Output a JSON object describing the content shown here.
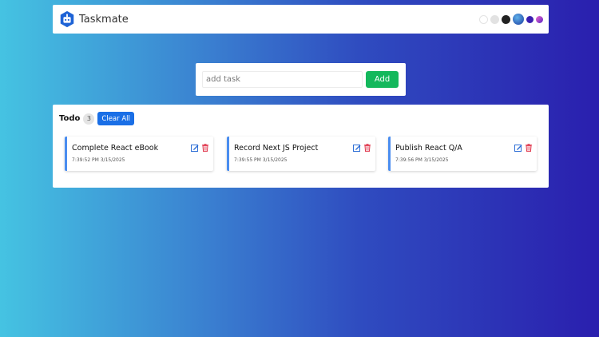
{
  "app": {
    "title": "Taskmate"
  },
  "themes": [
    "light-theme",
    "gray-theme",
    "dark-theme",
    "ocean-gradient-theme",
    "purple-theme",
    "pink-purple-theme"
  ],
  "add_task": {
    "placeholder": "add task",
    "value": "",
    "button_label": "Add"
  },
  "todo": {
    "title": "Todo",
    "count": "3",
    "clear_label": "Clear All",
    "tasks": [
      {
        "title": "Complete React eBook",
        "timestamp": "7:39:52 PM 3/15/2025"
      },
      {
        "title": "Record Next JS Project",
        "timestamp": "7:39:55 PM 3/15/2025"
      },
      {
        "title": "Publish React Q/A",
        "timestamp": "7:39:56 PM 3/15/2025"
      }
    ]
  },
  "icons": {
    "edit": "edit-icon",
    "delete": "trash-icon"
  },
  "colors": {
    "accent_green": "#14b85c",
    "accent_blue": "#1a6fe6",
    "card_border": "#4a8df0",
    "delete_red": "#e0354b"
  }
}
